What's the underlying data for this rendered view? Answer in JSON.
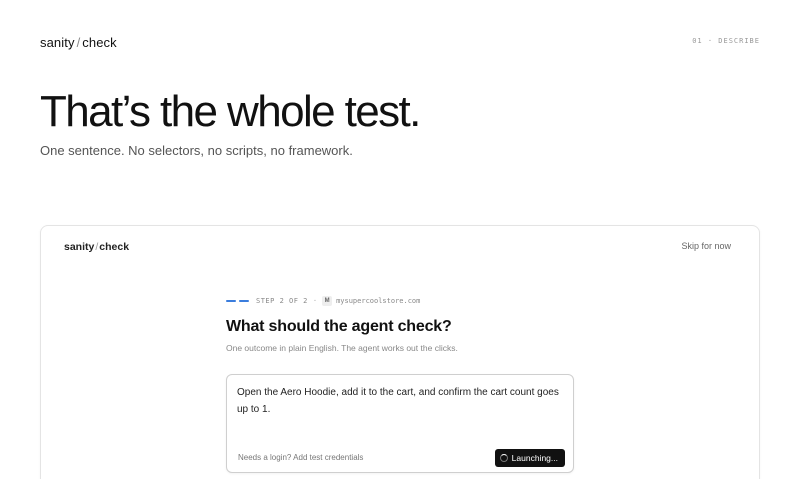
{
  "header": {
    "brand_left": "sanity",
    "brand_sep": "/",
    "brand_right": "check",
    "step_tag": "01 · DESCRIBE"
  },
  "hero": {
    "title": "That’s the whole test.",
    "subtitle": "One sentence. No selectors, no scripts, no framework."
  },
  "app": {
    "brand_left": "sanity",
    "brand_sep": "/",
    "brand_right": "check",
    "skip_label": "Skip for now",
    "step_label": "STEP 2 OF 2",
    "step_dot": "·",
    "site_favicon_letter": "M",
    "site_domain": "mysupercoolstore.com",
    "question": "What should the agent check?",
    "question_sub": "One outcome in plain English. The agent works out the clicks.",
    "prompt_value": "Open the Aero Hoodie, add it to the cart, and confirm the cart count goes up to 1.",
    "login_hint": "Needs a login?",
    "login_link": "Add test credentials",
    "launch_label": "Launching..."
  },
  "colors": {
    "accent": "#3b7ddd",
    "button_bg": "#111111"
  },
  "icons": [
    "spinner-icon",
    "site-favicon-icon",
    "progress-bars"
  ]
}
